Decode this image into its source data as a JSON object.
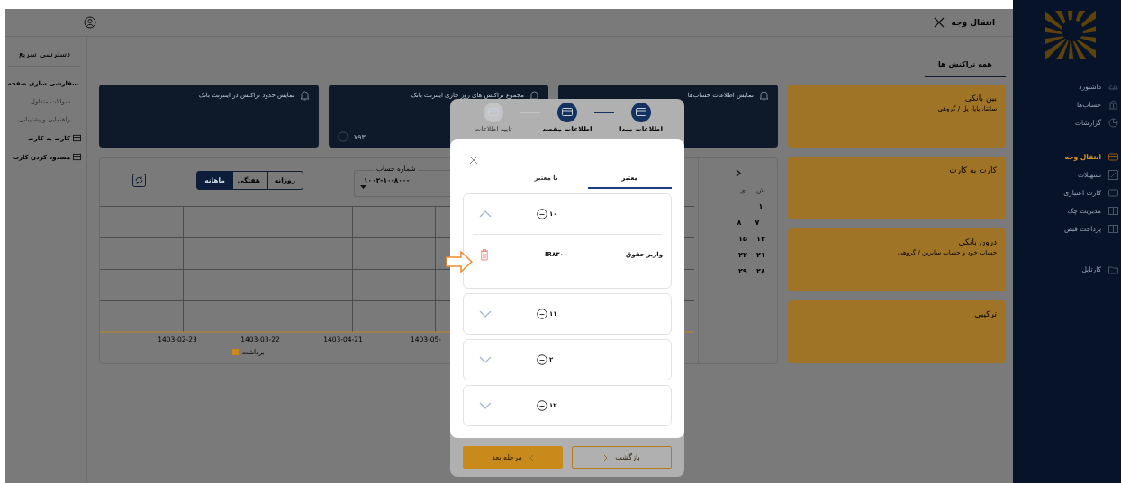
{
  "header": {
    "title": "انتقال وجه"
  },
  "sidebar": {
    "items": [
      {
        "label": "داشبورد",
        "selected": false
      },
      {
        "label": "حساب‌ها",
        "selected": false
      },
      {
        "label": "گزارشات",
        "selected": false
      },
      {
        "label": "انتقال وجه",
        "selected": true
      },
      {
        "label": "تسهیلات",
        "selected": false
      },
      {
        "label": "کارت اعتباری",
        "selected": false
      },
      {
        "label": "مدیریت چک",
        "selected": false
      },
      {
        "label": "پرداخت قبض",
        "selected": false
      },
      {
        "label": "کارتابل",
        "selected": false
      }
    ]
  },
  "quick_access": {
    "title": "دسترسی سریع",
    "items": [
      {
        "label": "سفارشی سازی صفحه",
        "disabled": false
      },
      {
        "label": "سوالات متداول",
        "disabled": true
      },
      {
        "label": "راهنمایی و پشتیبانی",
        "disabled": true
      },
      {
        "label": "کارت به کارت",
        "disabled": false
      },
      {
        "label": "مسدود کردن کارت",
        "disabled": false
      }
    ]
  },
  "tabs": [
    {
      "label": "همه تراکنش ها",
      "selected": true
    }
  ],
  "transfer_cards": [
    {
      "title": "بین بانکی",
      "subtitle": "ساتنا، پایا، پل / گروهی"
    },
    {
      "title": "کارت به کارت"
    },
    {
      "title": "درون بانکی",
      "subtitle": "حساب خود و حساب سایرین / گروهی"
    },
    {
      "title": "ترکیبی"
    }
  ],
  "info_cards": [
    {
      "title": "نمایش اطلاعات حساب‌ها"
    },
    {
      "title": "مجموع تراکنش های روز جاری اینترنت بانک",
      "value": "۷۹۳"
    },
    {
      "title": "نمایش حدود تراکنش در اینترنت بانک"
    }
  ],
  "chart_panel": {
    "account_field": {
      "label": "شماره حساب",
      "value": "۱۰۰۲-۱۰-۸۰۰-"
    },
    "periods": [
      {
        "label": "روزانه",
        "selected": false
      },
      {
        "label": "هفتگی",
        "selected": false
      },
      {
        "label": "ماهانه",
        "selected": true
      }
    ],
    "x_labels": [
      "1403-05-",
      "1403-04-21",
      "1403-03-22",
      "1403-02-23"
    ],
    "legend": [
      {
        "label": "برداشت",
        "color": "#c98a1c"
      }
    ],
    "calendar": {
      "weekdays": [
        "ش",
        "ی"
      ],
      "weeks": [
        [
          "۱"
        ],
        [
          "۷",
          "۸"
        ],
        [
          "۱۴",
          "۱۵"
        ],
        [
          "۲۱",
          "۲۲"
        ],
        [
          "۲۸",
          "۲۹"
        ]
      ]
    }
  },
  "stepper": {
    "steps": [
      {
        "label": "اطلاعات مبدا",
        "active": true
      },
      {
        "label": "اطلاعات مقصد",
        "active": true
      },
      {
        "label": "تایید اطلاعات",
        "active": false
      }
    ],
    "buttons": [
      {
        "label": "بازگشت",
        "kind": "secondary"
      },
      {
        "label": "مرحله بعد",
        "kind": "primary"
      }
    ]
  },
  "dialog": {
    "tabs": [
      {
        "label": "معتبر",
        "selected": true
      },
      {
        "label": "نا معتبر",
        "selected": false
      }
    ],
    "groups": [
      {
        "amount": "۱۰",
        "expanded": true,
        "rows": [
          {
            "title": "واریز حقوق",
            "iban": "IR۸۳۰"
          }
        ]
      },
      {
        "amount": "۱۱",
        "expanded": false
      },
      {
        "amount": "۲",
        "expanded": false
      },
      {
        "amount": "۱۲",
        "expanded": false
      }
    ]
  }
}
